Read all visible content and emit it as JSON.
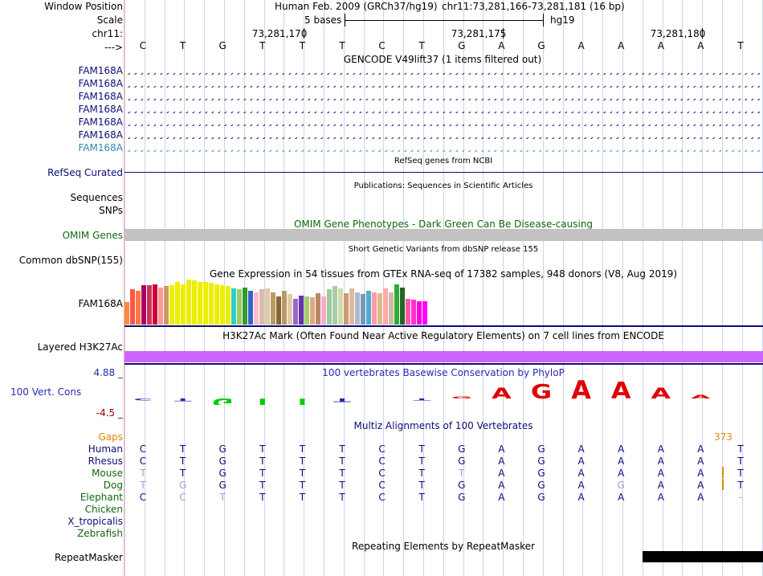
{
  "header": {
    "window_position_label": "Window Position",
    "scale_label": "Scale",
    "chrom_label": "chr11:",
    "arrow_label": "--->",
    "assembly": "Human Feb. 2009 (GRCh37/hg19)",
    "position": "chr11:73,281,166-73,281,181 (16 bp)",
    "scale_text": "5 bases",
    "scale_db": "hg19",
    "coords": [
      "73,281,170",
      "73,281,175",
      "73,281,180"
    ]
  },
  "sequence": [
    "C",
    "T",
    "G",
    "T",
    "T",
    "T",
    "C",
    "T",
    "G",
    "A",
    "G",
    "A",
    "A",
    "A",
    "A",
    "T"
  ],
  "gencode": {
    "title": "GENCODE V49lift37 (1 items filtered out)",
    "items": [
      "FAM168A",
      "FAM168A",
      "FAM168A",
      "FAM168A",
      "FAM168A",
      "FAM168A",
      "FAM168A"
    ],
    "colors": [
      "#0c0c78",
      "#0c0c78",
      "#0c0c78",
      "#0c0c78",
      "#0c0c78",
      "#0c0c78",
      "#2a8ab0"
    ]
  },
  "refseq": {
    "label": "RefSeq Curated",
    "title": "RefSeq genes from NCBI"
  },
  "publications": {
    "label_sequences": "Sequences",
    "label_snps": "SNPs",
    "title": "Publications: Sequences in Scientific Articles"
  },
  "omim": {
    "label": "OMIM Genes",
    "title": "OMIM Gene Phenotypes - Dark Green Can Be Disease-causing"
  },
  "dbsnp": {
    "label": "Common dbSNP(155)",
    "title": "Short Genetic Variants from dbSNP release 155"
  },
  "gtex": {
    "label": "FAM168A",
    "title": "Gene Expression in 54 tissues from GTEx RNA-seq of 17382 samples, 948 donors (V8, Aug 2019)",
    "values": [
      0.5,
      0.78,
      0.75,
      0.88,
      0.87,
      0.9,
      0.82,
      0.85,
      0.88,
      0.95,
      0.9,
      1.0,
      0.98,
      0.95,
      0.95,
      0.92,
      0.9,
      0.88,
      0.85,
      0.8,
      0.78,
      0.82,
      0.75,
      0.72,
      0.78,
      0.8,
      0.72,
      0.62,
      0.75,
      0.68,
      0.58,
      0.65,
      0.62,
      0.6,
      0.7,
      0.62,
      0.78,
      0.85,
      0.8,
      0.7,
      0.8,
      0.72,
      0.68,
      0.75,
      0.72,
      0.7,
      0.8,
      0.72,
      0.9,
      0.82,
      0.58,
      0.55,
      0.52,
      0.52
    ],
    "colors": [
      "#ff8844",
      "#ff5544",
      "#ff7744",
      "#aa0066",
      "#cc3355",
      "#cc0033",
      "#ff9999",
      "#cc9966",
      "#eeee00",
      "#eeee00",
      "#eeee00",
      "#eeee00",
      "#eeee00",
      "#eeee00",
      "#eeee00",
      "#eeee00",
      "#eeee00",
      "#eeee00",
      "#eeee00",
      "#33cccc",
      "#99cc66",
      "#339933",
      "#3366cc",
      "#ffbbcc",
      "#ddbbaa",
      "#ddccaa",
      "#bb9966",
      "#886633",
      "#bb9966",
      "#ddccaa",
      "#9966cc",
      "#6633aa",
      "#aacc66",
      "#ddaa88",
      "#bb8866",
      "#ffaacc",
      "#99cc99",
      "#aaccaa",
      "#ccddaa",
      "#cc9977",
      "#ddbb99",
      "#aabbcc",
      "#7799bb",
      "#55aacc",
      "#ff99aa",
      "#ddbb88",
      "#ffaaaa",
      "#ccbbaa",
      "#33aa33",
      "#226622",
      "#ff55aa",
      "#ff33cc",
      "#ff00dd",
      "#ff00ff"
    ]
  },
  "h3k27ac": {
    "label": "Layered H3K27Ac",
    "title": "H3K27Ac Mark (Often Found Near Active Regulatory Elements) on 7 cell lines from ENCODE"
  },
  "phylop": {
    "label": "100 Vert. Cons",
    "max_label": "4.88 _",
    "min_label": "-4.5 _",
    "title": "100 vertebrates Basewise Conservation by PhyloP",
    "values": [
      0.1,
      0.15,
      0.45,
      0.9,
      0.95,
      0.2,
      0.0,
      0.1,
      -0.1,
      -0.6,
      -0.8,
      -1.0,
      -0.9,
      -0.6,
      -0.2,
      0.0
    ]
  },
  "multiz": {
    "title": "Multiz Alignments of 100 Vertebrates",
    "gaps_label": "Gaps",
    "gaps_count": "373",
    "species": [
      {
        "name": "Human",
        "color": "#0c0c78",
        "seq": [
          "C",
          "T",
          "G",
          "T",
          "T",
          "T",
          "C",
          "T",
          "G",
          "A",
          "G",
          "A",
          "A",
          "A",
          "A",
          "T"
        ]
      },
      {
        "name": "Rhesus",
        "color": "#0c0c78",
        "seq": [
          "C",
          "T",
          "G",
          "T",
          "T",
          "T",
          "C",
          "T",
          "G",
          "A",
          "G",
          "A",
          "A",
          "A",
          "A",
          "T"
        ]
      },
      {
        "name": "Mouse",
        "color": "#116611",
        "seq": [
          "T",
          "T",
          "G",
          "T",
          "T",
          "T",
          "C",
          "T",
          "T",
          "A",
          "G",
          "A",
          "A",
          "A",
          "A",
          "T"
        ]
      },
      {
        "name": "Dog",
        "color": "#116611",
        "seq": [
          "T",
          "G",
          "G",
          "T",
          "T",
          "T",
          "C",
          "T",
          "G",
          "A",
          "G",
          "A",
          "G",
          "A",
          "A",
          "T"
        ]
      },
      {
        "name": "Elephant",
        "color": "#116611",
        "seq": [
          "C",
          "C",
          "T",
          "T",
          "T",
          "T",
          "C",
          "T",
          "G",
          "A",
          "G",
          "A",
          "A",
          "A",
          "A",
          "-"
        ]
      },
      {
        "name": "Chicken",
        "color": "#116611",
        "seq": []
      },
      {
        "name": "X_tropicalis",
        "color": "#0c0c78",
        "seq": []
      },
      {
        "name": "Zebrafish",
        "color": "#116611",
        "seq": []
      }
    ],
    "faded": [
      [
        false,
        false,
        false,
        false,
        false,
        false,
        false,
        false,
        false,
        false,
        false,
        false,
        false,
        false,
        false,
        false
      ],
      [
        false,
        false,
        false,
        false,
        false,
        false,
        false,
        false,
        false,
        false,
        false,
        false,
        false,
        false,
        false,
        false
      ],
      [
        true,
        false,
        false,
        false,
        false,
        false,
        false,
        false,
        true,
        false,
        false,
        false,
        false,
        false,
        false,
        false
      ],
      [
        true,
        true,
        false,
        false,
        false,
        false,
        false,
        false,
        false,
        false,
        false,
        false,
        true,
        false,
        false,
        false
      ],
      [
        false,
        true,
        true,
        false,
        false,
        false,
        false,
        false,
        false,
        false,
        false,
        false,
        false,
        false,
        false,
        true
      ]
    ]
  },
  "repeatmasker": {
    "label": "RepeatMasker",
    "title": "Repeating Elements by RepeatMasker"
  },
  "colors": {
    "label_navy": "#0c0c78",
    "omim_green": "#116611",
    "phylop_blue": "#2a2ab0",
    "phylop_red": "#e00000",
    "phylop_green": "#00cc00",
    "h3k27ac": "#cc66ff",
    "gaps": "#dd8800",
    "min_label": "#880000"
  }
}
